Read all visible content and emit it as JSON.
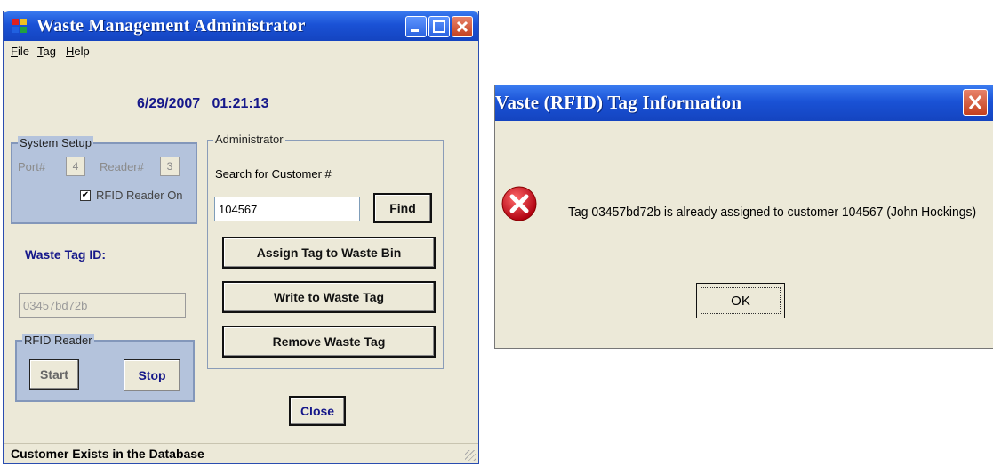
{
  "main_window": {
    "title": "Waste Management Administrator",
    "menu": [
      {
        "hotkey": "F",
        "rest": "ile"
      },
      {
        "hotkey": "T",
        "rest": "ag"
      },
      {
        "hotkey": "H",
        "rest": "elp"
      }
    ],
    "date": "6/29/2007",
    "time": "01:21:13",
    "system_setup": {
      "legend": "System Setup",
      "port_label": "Port#",
      "port_value": "4",
      "reader_label": "Reader#",
      "reader_value": "3",
      "rfid_on_label": "RFID Reader On",
      "rfid_on_checked": true
    },
    "waste_tag_label": "Waste Tag ID:",
    "waste_tag_value": "03457bd72b",
    "rfid_reader": {
      "legend": "RFID Reader",
      "start_label": "Start",
      "stop_label": "Stop"
    },
    "administrator": {
      "legend": "Administrator",
      "search_label": "Search for Customer #",
      "search_value": "104567",
      "find_label": "Find",
      "assign_label": "Assign Tag to Waste Bin",
      "write_label": "Write to Waste Tag",
      "remove_label": "Remove Waste Tag"
    },
    "close_label": "Close",
    "status": "Customer Exists in the Database"
  },
  "dialog": {
    "title": "Vaste (RFID) Tag Information",
    "message": "Tag 03457bd72b is already assigned to customer 104567 (John Hockings)",
    "ok_label": "OK",
    "icon": "error-icon"
  },
  "colors": {
    "titlebar": "#1a52d6",
    "accent_text": "#16188a",
    "group_blue": "#b4c3dc",
    "window_bg": "#ece9d8",
    "error_red": "#c8101a"
  }
}
